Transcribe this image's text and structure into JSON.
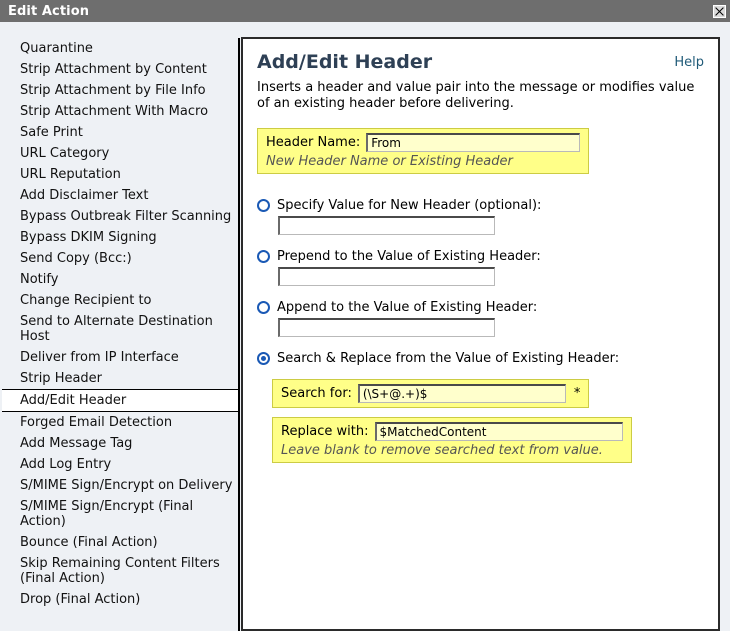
{
  "window": {
    "title": "Edit Action",
    "close_icon": "close-icon"
  },
  "sidebar": {
    "items": [
      {
        "label": "Quarantine",
        "selected": false
      },
      {
        "label": "Strip Attachment by Content",
        "selected": false
      },
      {
        "label": "Strip Attachment by File Info",
        "selected": false
      },
      {
        "label": "Strip Attachment With Macro",
        "selected": false
      },
      {
        "label": "Safe Print",
        "selected": false
      },
      {
        "label": "URL Category",
        "selected": false
      },
      {
        "label": "URL Reputation",
        "selected": false
      },
      {
        "label": "Add Disclaimer Text",
        "selected": false
      },
      {
        "label": "Bypass Outbreak Filter Scanning",
        "selected": false
      },
      {
        "label": "Bypass DKIM Signing",
        "selected": false
      },
      {
        "label": "Send Copy (Bcc:)",
        "selected": false
      },
      {
        "label": "Notify",
        "selected": false
      },
      {
        "label": "Change Recipient to",
        "selected": false
      },
      {
        "label": "Send to Alternate Destination Host",
        "selected": false
      },
      {
        "label": "Deliver from IP Interface",
        "selected": false
      },
      {
        "label": "Strip Header",
        "selected": false
      },
      {
        "label": "Add/Edit Header",
        "selected": true
      },
      {
        "label": "Forged Email Detection",
        "selected": false
      },
      {
        "label": "Add Message Tag",
        "selected": false
      },
      {
        "label": "Add Log Entry",
        "selected": false
      },
      {
        "label": "S/MIME Sign/Encrypt on Delivery",
        "selected": false
      },
      {
        "label": "S/MIME Sign/Encrypt (Final Action)",
        "selected": false
      },
      {
        "label": "Bounce (Final Action)",
        "selected": false
      },
      {
        "label": "Skip Remaining Content Filters (Final Action)",
        "selected": false
      },
      {
        "label": "Drop (Final Action)",
        "selected": false
      }
    ]
  },
  "panel": {
    "title": "Add/Edit Header",
    "help_label": "Help",
    "description": "Inserts a header and value pair into the message or modifies value of an existing header before delivering.",
    "header_name": {
      "label": "Header Name:",
      "value": "From",
      "hint": "New Header Name or Existing Header"
    },
    "options": [
      {
        "label": "Specify Value for New Header (optional):",
        "selected": false,
        "value": ""
      },
      {
        "label": "Prepend to the Value of Existing Header:",
        "selected": false,
        "value": ""
      },
      {
        "label": "Append to the Value of Existing Header:",
        "selected": false,
        "value": ""
      },
      {
        "label": "Search & Replace from the Value of Existing Header:",
        "selected": true
      }
    ],
    "search_for": {
      "label": "Search for:",
      "value": "(\\S+@.+)$",
      "required_marker": "*"
    },
    "replace_with": {
      "label": "Replace with:",
      "value": "$MatchedContent",
      "hint": "Leave blank to remove searched text from value."
    }
  },
  "colors": {
    "titlebar": "#6e6e6e",
    "body_bg": "#eef1f5",
    "highlight": "#ffff88",
    "accent_radio": "#1a59b5",
    "link": "#1f5a78",
    "heading": "#2e4055"
  }
}
